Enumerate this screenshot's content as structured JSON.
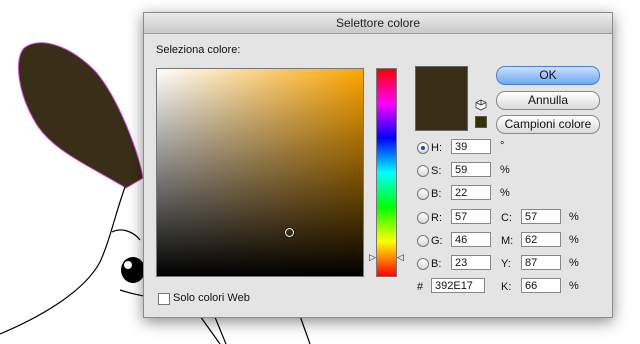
{
  "dialog": {
    "title": "Selettore colore",
    "picker_label": "Seleziona colore:",
    "web_only_label": "Solo colori Web",
    "hue_arrow_left": "▷",
    "hue_arrow_right": "◁"
  },
  "buttons": {
    "ok": "OK",
    "cancel": "Annulla",
    "swatches": "Campioni colore"
  },
  "hsb": {
    "h_label": "H:",
    "h_value": "39",
    "h_unit": "°",
    "s_label": "S:",
    "s_value": "59",
    "s_unit": "%",
    "b_label": "B:",
    "b_value": "22",
    "b_unit": "%"
  },
  "rgb": {
    "r_label": "R:",
    "r_value": "57",
    "g_label": "G:",
    "g_value": "46",
    "b_label": "B:",
    "b_value": "23"
  },
  "cmyk": {
    "c_label": "C:",
    "c_value": "57",
    "c_unit": "%",
    "m_label": "M:",
    "m_value": "62",
    "m_unit": "%",
    "y_label": "Y:",
    "y_value": "87",
    "y_unit": "%",
    "k_label": "K:",
    "k_value": "66",
    "k_unit": "%"
  },
  "hex": {
    "label": "#",
    "value": "392E17"
  },
  "colors": {
    "current": "#392E17",
    "websafe": "#333300",
    "ear_fill": "#392E17"
  },
  "icons": {
    "cube": "cube-icon"
  }
}
